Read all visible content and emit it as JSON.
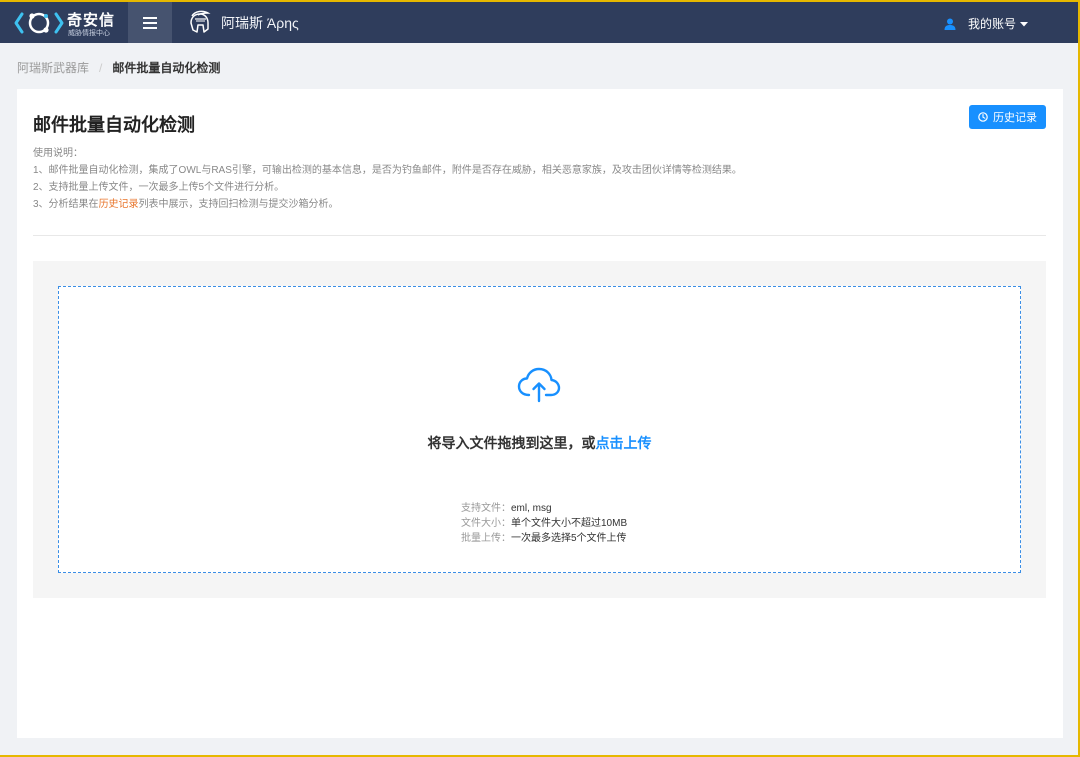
{
  "topbar": {
    "logo_title": "奇安信",
    "logo_subtitle": "威胁情报中心",
    "product_name": "阿瑞斯 Άρης",
    "account_label": "我的账号"
  },
  "breadcrumb": {
    "parent": "阿瑞斯武器库",
    "separator": "/",
    "current": "邮件批量自动化检测"
  },
  "page": {
    "title": "邮件批量自动化检测",
    "history_button": "历史记录",
    "instructions": {
      "heading": "使用说明：",
      "line1": "1、邮件批量自动化检测，集成了OWL与RAS引擎，可输出检测的基本信息，是否为钓鱼邮件，附件是否存在威胁，相关恶意家族，及攻击团伙详情等检测结果。",
      "line2": "2、支持批量上传文件，一次最多上传5个文件进行分析。",
      "line3_prefix": "3、分析结果在",
      "line3_link": "历史记录",
      "line3_suffix": "列表中展示，支持回扫检测与提交沙箱分析。"
    }
  },
  "upload": {
    "drop_text": "将导入文件拖拽到这里，或",
    "drop_link": "点击上传",
    "constraints": [
      {
        "label": "支持文件：",
        "value": "eml, msg"
      },
      {
        "label": "文件大小：",
        "value": "单个文件大小不超过10MB"
      },
      {
        "label": "批量上传：",
        "value": "一次最多选择5个文件上传"
      }
    ]
  },
  "colors": {
    "topbar": "#2f3d5c",
    "accent": "#1890ff",
    "link_orange": "#e8762d",
    "frame": "#e6b800"
  },
  "icons": {
    "logo": "qianxin-logo-icon",
    "menu": "menu-icon",
    "product": "spartan-helmet-icon",
    "user": "user-icon",
    "caret": "caret-down-icon",
    "history": "clock-icon",
    "upload": "cloud-upload-icon"
  }
}
